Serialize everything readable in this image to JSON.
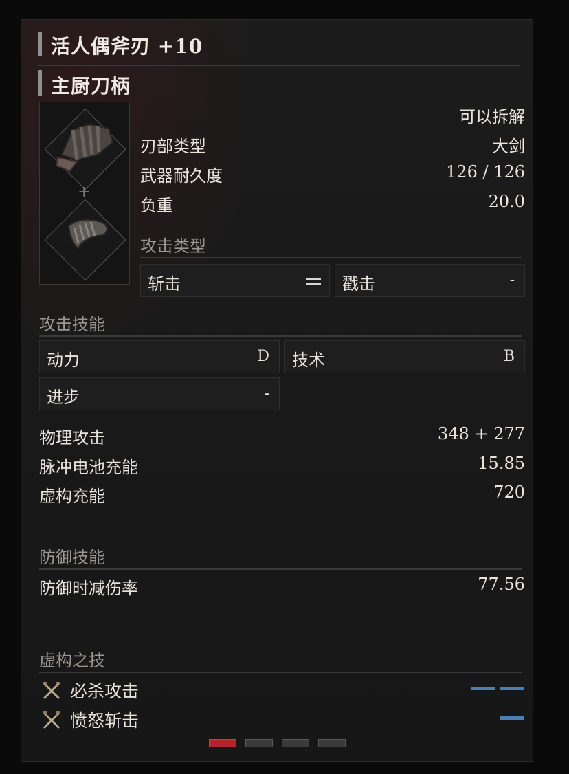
{
  "item": {
    "title": "活人偶斧刃 +10",
    "subtitle": "主厨刀柄",
    "dismantle": "可以拆解"
  },
  "stats_top": [
    {
      "label": "刃部类型",
      "value": "大剑"
    },
    {
      "label": "武器耐久度",
      "value": "126 / 126"
    },
    {
      "label": "负重",
      "value": "20.0"
    }
  ],
  "attack_type": {
    "title": "攻击类型",
    "slash_label": "斩击",
    "pierce_label": "戳击",
    "pierce_value": "-"
  },
  "attack_skill": {
    "title": "攻击技能",
    "cells": [
      {
        "label": "动力",
        "value": "D"
      },
      {
        "label": "技术",
        "value": "B"
      },
      {
        "label": "进步",
        "value": "-"
      }
    ]
  },
  "attack_stats": [
    {
      "label": "物理攻击",
      "value": "348 + 277"
    },
    {
      "label": "脉冲电池充能",
      "value": "15.85"
    },
    {
      "label": "虚构充能",
      "value": "720"
    }
  ],
  "defense": {
    "title": "防御技能",
    "label": "防御时减伤率",
    "value": "77.56"
  },
  "fable": {
    "title": "虚构之技",
    "skills": [
      {
        "label": "必杀攻击",
        "icon": "crossed-swords-icon",
        "slots": 2
      },
      {
        "label": "愤怒斩击",
        "icon": "crossed-swords-icon",
        "slots": 1
      }
    ]
  },
  "colors": {
    "accent_red": "#b3252a",
    "fable_slot_blue": "#4c7fb4"
  },
  "pager": {
    "count": 4,
    "active_index": 0
  }
}
